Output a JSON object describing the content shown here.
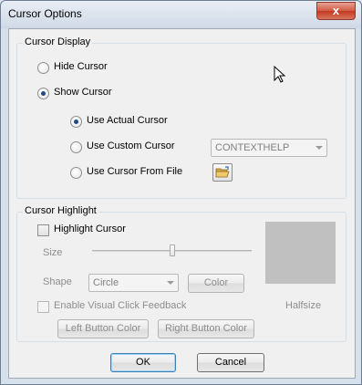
{
  "window": {
    "title": "Cursor Options",
    "close_glyph": "x"
  },
  "cursor_display": {
    "group_label": "Cursor Display",
    "hide_cursor": {
      "label": "Hide Cursor",
      "checked": false
    },
    "show_cursor": {
      "label": "Show Cursor",
      "checked": true
    },
    "use_actual": {
      "label": "Use Actual Cursor",
      "checked": true
    },
    "use_custom": {
      "label": "Use Custom Cursor",
      "checked": false
    },
    "custom_cursor_value": "CONTEXTHELP",
    "use_from_file": {
      "label": "Use Cursor From File",
      "checked": false
    }
  },
  "cursor_highlight": {
    "group_label": "Cursor Highlight",
    "highlight_cursor": {
      "label": "Highlight Cursor",
      "checked": false
    },
    "size_label": "Size",
    "size_level": 0.5,
    "shape_label": "Shape",
    "shape_value": "Circle",
    "color_button": "Color",
    "halfsize_label": "Halfsize",
    "visual_click": {
      "label": "Enable Visual Click Feedback",
      "checked": false
    },
    "left_button_color": "Left Button Color",
    "right_button_color": "Right Button Color",
    "preview_color": "#c0c0c0"
  },
  "footer": {
    "ok": "OK",
    "cancel": "Cancel"
  },
  "icons": {
    "folder": "folder-open-icon",
    "mouse": "arrow-cursor-icon"
  }
}
